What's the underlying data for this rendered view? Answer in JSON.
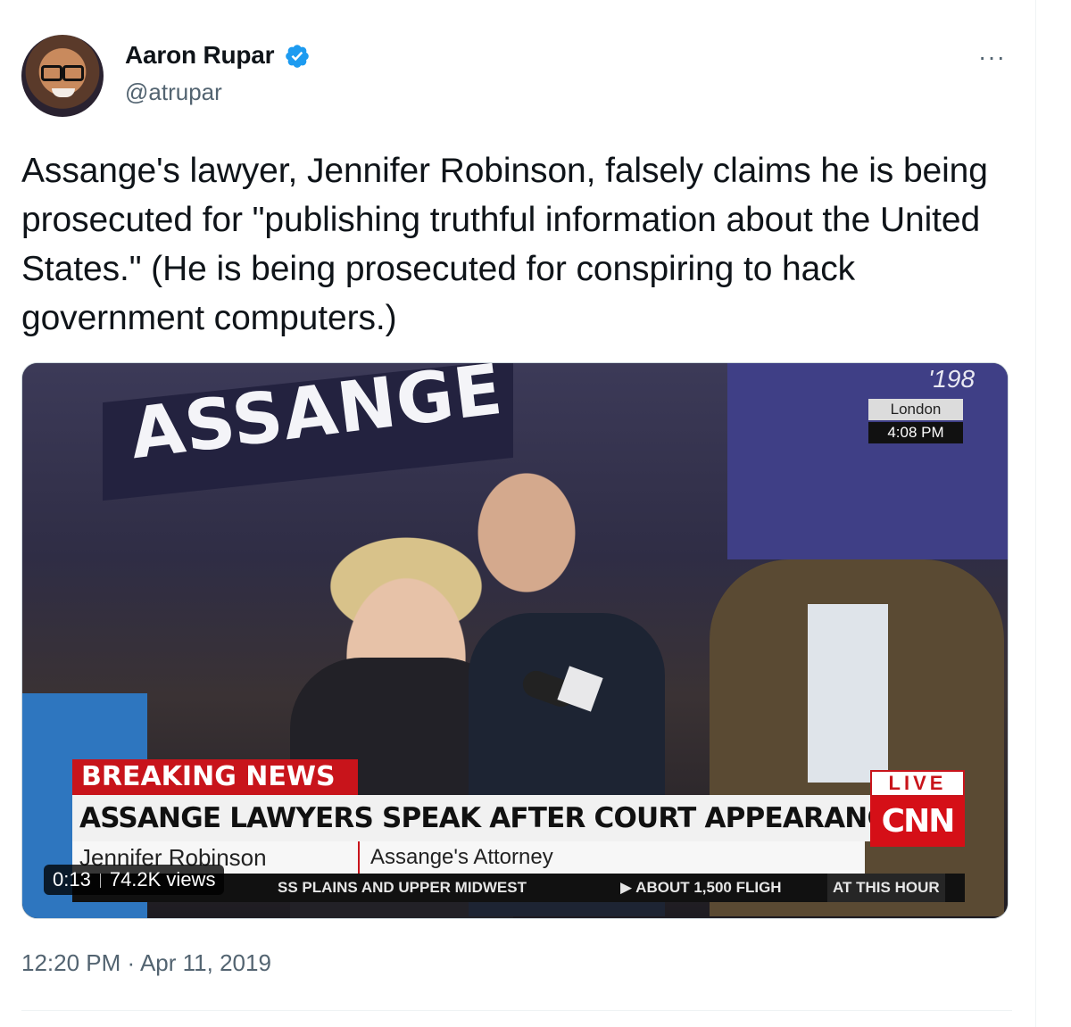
{
  "author": {
    "name": "Aaron Rupar",
    "handle": "@atrupar",
    "verified_icon": "verified-badge-icon"
  },
  "more_label": "···",
  "tweet": {
    "text": "Assange's lawyer, Jennifer Robinson, falsely claims he is being prosecuted for \"publishing truthful information about the United States.\" (He is being prosecuted for conspiring to hack government computers.)",
    "timestamp": "12:20 PM · Apr 11, 2019"
  },
  "video": {
    "duration": "0:13",
    "views": "74.2K views",
    "banner_text": "ASSANGE",
    "poster_text": "'198",
    "location_city": "London",
    "location_time": "4:08 PM",
    "breaking_label": "BREAKING NEWS",
    "headline": "ASSANGE LAWYERS SPEAK AFTER COURT APPEARANCE",
    "live_label": "LIVE",
    "network_logo": "CNN",
    "speaker_name": "Jennifer Robinson",
    "speaker_title": "Assange's Attorney",
    "ticker_1": "SS PLAINS AND UPPER MIDWEST",
    "ticker_2": "▶ ABOUT 1,500 FLIGH",
    "ticker_3": "AT THIS HOUR"
  },
  "colors": {
    "verified": "#1d9bf0",
    "secondary_text": "#536471",
    "cnn_red": "#c8141b"
  }
}
